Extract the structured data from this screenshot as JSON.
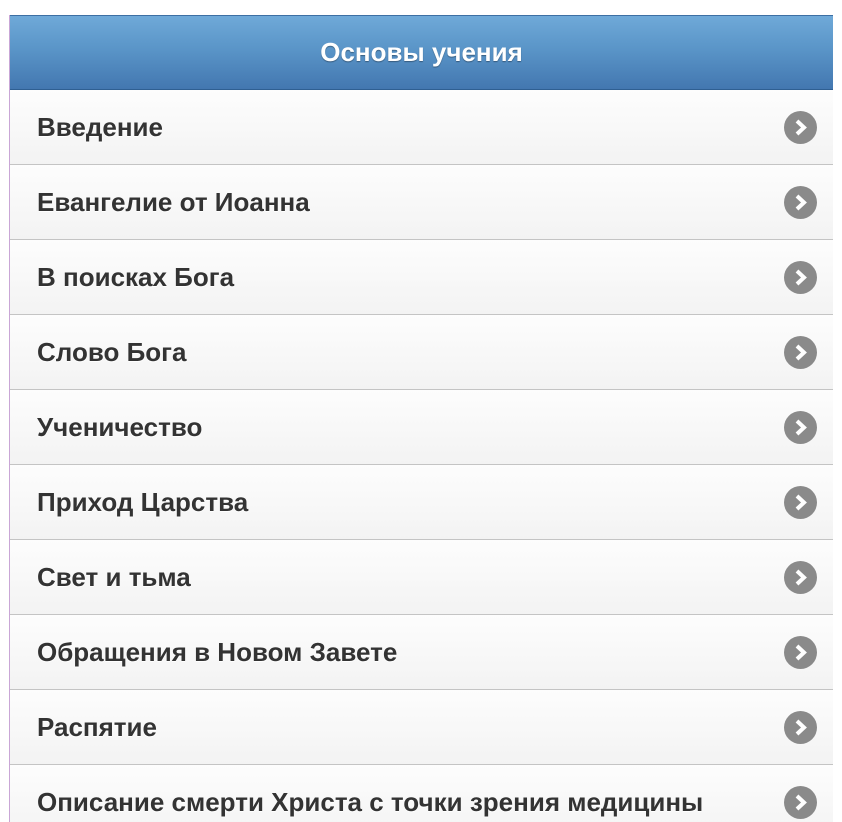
{
  "header": {
    "title": "Основы учения"
  },
  "list": {
    "items": [
      {
        "label": "Введение"
      },
      {
        "label": "Евангелие от Иоанна"
      },
      {
        "label": "В поисках Бога"
      },
      {
        "label": "Слово Бога"
      },
      {
        "label": "Ученичество"
      },
      {
        "label": "Приход Царства"
      },
      {
        "label": "Свет и тьма"
      },
      {
        "label": "Обращения в Новом Завете"
      },
      {
        "label": "Распятие"
      },
      {
        "label": "Описание смерти Христа с точки зрения медицины"
      }
    ],
    "item_icon": "chevron-right-icon"
  },
  "colors": {
    "header_top": "#6fa9d8",
    "header_bottom": "#4377b0",
    "item_text": "#333333",
    "icon_bg": "#8a8a8a"
  }
}
